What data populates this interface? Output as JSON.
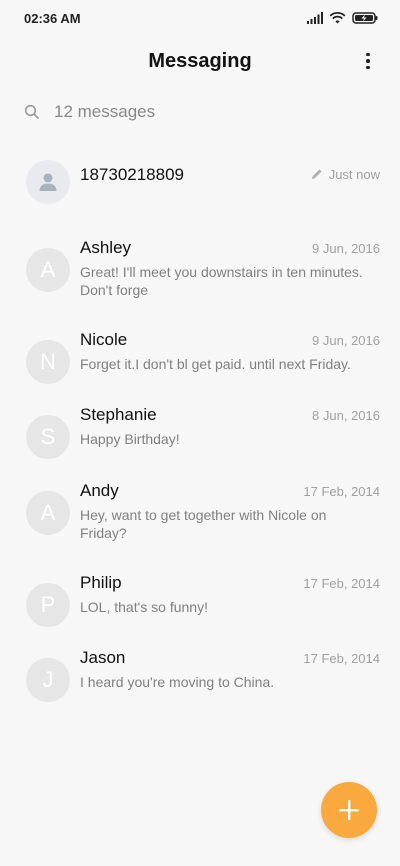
{
  "status": {
    "time": "02:36 AM",
    "icons": [
      "signal-icon",
      "wifi-icon",
      "battery-charging-icon"
    ]
  },
  "app": {
    "title": "Messaging",
    "menu_icon": "more-vert-icon"
  },
  "search": {
    "placeholder": "12 messages",
    "icon": "search-icon"
  },
  "conversations": [
    {
      "initial": "",
      "name": "18730218809",
      "date": "Just now",
      "snippet": "",
      "draft": true
    },
    {
      "initial": "A",
      "name": "Ashley",
      "date": "9 Jun, 2016",
      "snippet": "Great! I'll meet you downstairs in ten minutes. Don't forge"
    },
    {
      "initial": "N",
      "name": "Nicole",
      "date": "9 Jun, 2016",
      "snippet": "Forget it.I don't bl get paid. until next Friday."
    },
    {
      "initial": "S",
      "name": "Stephanie",
      "date": "8 Jun, 2016",
      "snippet": "Happy Birthday!"
    },
    {
      "initial": "A",
      "name": "Andy",
      "date": "17 Feb, 2014",
      "snippet": "Hey, want to get together with Nicole on Friday?"
    },
    {
      "initial": "P",
      "name": "Philip",
      "date": "17 Feb, 2014",
      "snippet": "LOL, that's so funny!"
    },
    {
      "initial": "J",
      "name": "Jason",
      "date": "17 Feb, 2014",
      "snippet": "I heard you're moving to China."
    }
  ],
  "colors": {
    "accent": "#f9a93d",
    "avatar_bg": "#e6e6e6",
    "background": "#f7f7f7"
  },
  "fab": {
    "icon": "plus-icon"
  }
}
